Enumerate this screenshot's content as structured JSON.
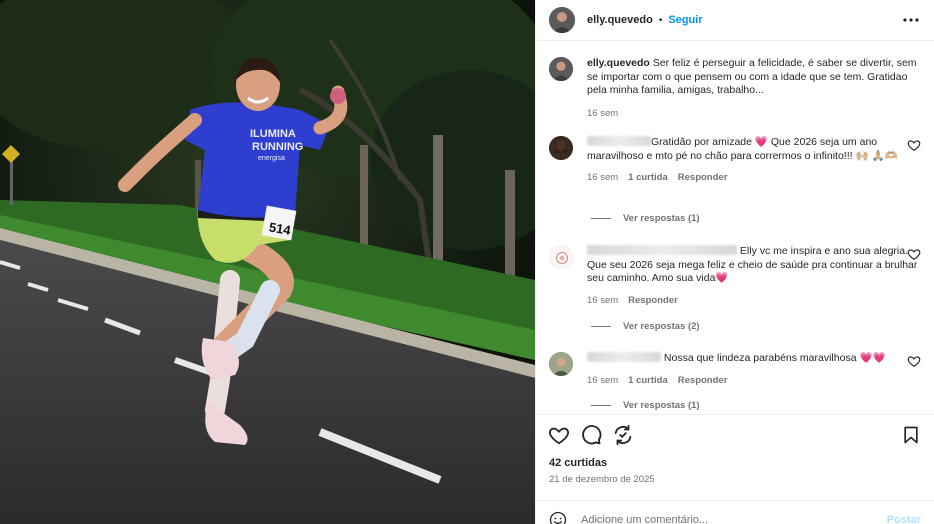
{
  "post": {
    "username": "elly.quevedo",
    "follow_label": "Seguir",
    "dot": "•",
    "caption": {
      "username": "elly.quevedo",
      "text": "Ser feliz é perseguir a felicidade, é saber se divertir, sem se importar com o que pensem ou com a idade que se tem. Gratidao pela minha familia, amigas, trabalho...",
      "time": "16 sem"
    },
    "photo": {
      "shirt_line1": "ILUMINA",
      "shirt_line2": "RUNNING",
      "shirt_sponsor": "energisa",
      "bib_number": "514"
    },
    "comments": [
      {
        "text": "Gratidão por amizade 💗 Que 2026 seja um ano maravilhoso e mto pé no chão para corrermos o infinito!!! 🙌🏼 🙏🏼🫶🏼",
        "time": "16 sem",
        "likes": "1 curtida",
        "reply": "Responder",
        "view_replies": "Ver respostas (1)"
      },
      {
        "text": "Elly vc me inspira e ano sua alegria. Que seu 2026 seja mega feliz e cheio de saúde pra continuar a brulhar seu caminho. Amo sua vida💗",
        "time": "16 sem",
        "reply": "Responder",
        "view_replies": "Ver respostas (2)"
      },
      {
        "text": "Nossa que lindeza parabéns maravilhosa 💗💗",
        "time": "16 sem",
        "likes": "1 curtida",
        "reply": "Responder",
        "view_replies": "Ver respostas (1)"
      }
    ],
    "likes_count": "42 curtidas",
    "date": "21 de dezembro de 2025",
    "add_comment_placeholder": "Adicione um comentário...",
    "post_label": "Postar",
    "icons": {
      "more": "more-horizontal-icon",
      "like": "heart-icon",
      "comment": "comment-icon",
      "share": "share-icon",
      "save": "bookmark-icon",
      "emoji": "emoji-icon"
    },
    "colors": {
      "link_blue": "#0095f6",
      "post_disabled": "#b2dffc",
      "secondary_text": "#737373"
    }
  }
}
